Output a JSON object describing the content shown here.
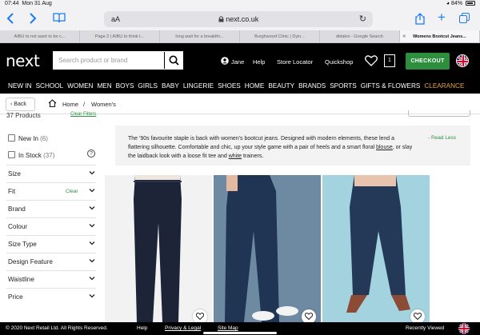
{
  "status": {
    "time": "07:44",
    "date": "Mon 31 Aug",
    "battery": "84%"
  },
  "browser": {
    "aa": "aA",
    "url": "next.co.uk",
    "tabs": [
      "AIBU to not want to be c...",
      "Page 2 | AIBU to think t...",
      "long wait for a breakthr...",
      "Burghwood Clinic | Dyin...",
      "didakoi - Google Search",
      "Womens Bootcut Jeans..."
    ]
  },
  "header": {
    "logo": "next",
    "search_placeholder": "Search product or brand",
    "user": "Jane",
    "help": "Help",
    "store_locator": "Store Locator",
    "quickshop": "Quickshop",
    "bag_count": "1",
    "checkout": "CHECKOUT"
  },
  "nav": [
    "NEW IN",
    "SCHOOL",
    "WOMEN",
    "MEN",
    "BOYS",
    "GIRLS",
    "BABY",
    "LINGERIE",
    "SHOES",
    "HOME",
    "BEAUTY",
    "BRANDS",
    "SPORTS",
    "GIFTS & FLOWERS",
    "CLEARANCE"
  ],
  "breadcrumb": {
    "back": "Back",
    "home": "Home",
    "sep": "/",
    "current": "Women's"
  },
  "sidebar": {
    "cut_text": "37 Products",
    "cut_link": "Clear Filters",
    "new_in": {
      "label": "New In",
      "count": "(6)"
    },
    "in_stock": {
      "label": "In Stock",
      "count": "(37)"
    },
    "help": "?",
    "filters": [
      {
        "label": "Size",
        "clear": ""
      },
      {
        "label": "Fit",
        "clear": "Clear"
      },
      {
        "label": "Brand",
        "clear": ""
      },
      {
        "label": "Colour",
        "clear": ""
      },
      {
        "label": "Size Type",
        "clear": ""
      },
      {
        "label": "Design Feature",
        "clear": ""
      },
      {
        "label": "Waistline",
        "clear": ""
      },
      {
        "label": "Price",
        "clear": ""
      }
    ]
  },
  "info": {
    "text_1": "The '90s favourite staple is back with women's bootcut jeans. Designed with modern elements, these lend a flattering silhouette. Comfortable and chic, up your style game with a pair of heels and a smart floral ",
    "link_1": "blouse",
    "text_2": ", or slay the laidback look with a loose fit tee and ",
    "link_2": "white",
    "text_3": " trainers.",
    "read_less": "- Read Less"
  },
  "footer": {
    "copyright": "© 2020 Next Retail Ltd. All Rights Reserved.",
    "help": "Help",
    "privacy": "Privacy & Legal",
    "sitemap": "Site Map",
    "recently_viewed": "Recently Viewed"
  },
  "colors": {
    "accent_green": "#2d8f3e",
    "clearance": "#e8a34a",
    "header_bg": "#000000",
    "browser_blue": "#1a7cf5"
  },
  "icons": [
    "chevron-left-icon",
    "chevron-right-icon",
    "book-icon",
    "lock-icon",
    "reload-icon",
    "share-icon",
    "plus-icon",
    "tabs-icon",
    "search-icon",
    "user-icon",
    "heart-icon",
    "bag-icon",
    "uk-flag-icon",
    "home-icon",
    "help-icon",
    "chevron-down-icon"
  ]
}
